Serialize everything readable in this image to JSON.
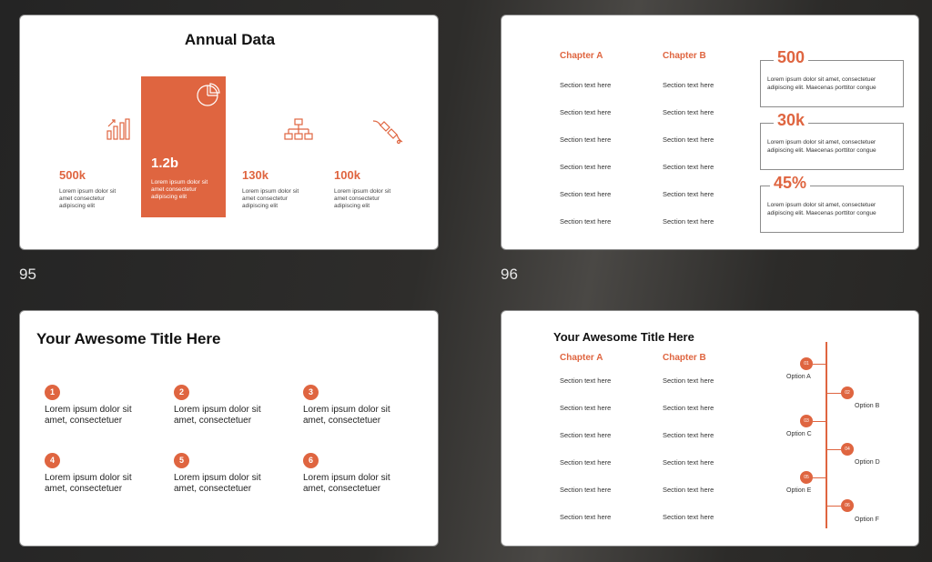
{
  "slide_numbers": [
    "95",
    "96"
  ],
  "slide95": {
    "title": "Annual Data",
    "stats": [
      {
        "value": "500k",
        "desc": "Lorem ipsum dolor sit amet consectetur adipiscing elit",
        "icon": "bar-growth-icon"
      },
      {
        "value": "1.2b",
        "desc": "Lorem ipsum dolor sit amet consectetur adipiscing elit",
        "icon": "pie-chart-icon"
      },
      {
        "value": "130k",
        "desc": "Lorem ipsum dolor sit amet consectetur adipiscing elit",
        "icon": "org-chart-icon"
      },
      {
        "value": "100k",
        "desc": "Lorem ipsum dolor sit amet consectetur adipiscing elit",
        "icon": "plug-icon"
      }
    ]
  },
  "slide96": {
    "chapter_a": "Chapter A",
    "chapter_b": "Chapter B",
    "section_text": "Section text here",
    "stats": [
      {
        "value": "500",
        "desc": "Lorem ipsum dolor sit amet, consectetuer adipiscing elit. Maecenas porttitor congue"
      },
      {
        "value": "30k",
        "desc": "Lorem ipsum dolor sit amet, consectetuer adipiscing elit. Maecenas porttitor congue"
      },
      {
        "value": "45%",
        "desc": "Lorem ipsum dolor sit amet, consectetuer adipiscing elit. Maecenas porttitor congue"
      }
    ]
  },
  "slide97": {
    "title": "Your Awesome Title Here",
    "items": [
      {
        "num": "1",
        "text": "Lorem ipsum dolor sit amet, consectetuer"
      },
      {
        "num": "2",
        "text": "Lorem ipsum dolor sit amet, consectetuer"
      },
      {
        "num": "3",
        "text": "Lorem ipsum dolor sit amet, consectetuer"
      },
      {
        "num": "4",
        "text": "Lorem ipsum dolor sit amet, consectetuer"
      },
      {
        "num": "5",
        "text": "Lorem ipsum dolor sit amet, consectetuer"
      },
      {
        "num": "6",
        "text": "Lorem ipsum dolor sit amet, consectetuer"
      }
    ]
  },
  "slide98": {
    "title": "Your Awesome Title Here",
    "chapter_a": "Chapter A",
    "chapter_b": "Chapter B",
    "section_text": "Section text here",
    "timeline": [
      {
        "num": "01",
        "label": "Option A"
      },
      {
        "num": "02",
        "label": "Option B"
      },
      {
        "num": "03",
        "label": "Option C"
      },
      {
        "num": "04",
        "label": "Option D"
      },
      {
        "num": "05",
        "label": "Option E"
      },
      {
        "num": "06",
        "label": "Option F"
      }
    ]
  },
  "colors": {
    "accent": "#df6540",
    "background": "#2a2927",
    "slide": "#ffffff"
  }
}
